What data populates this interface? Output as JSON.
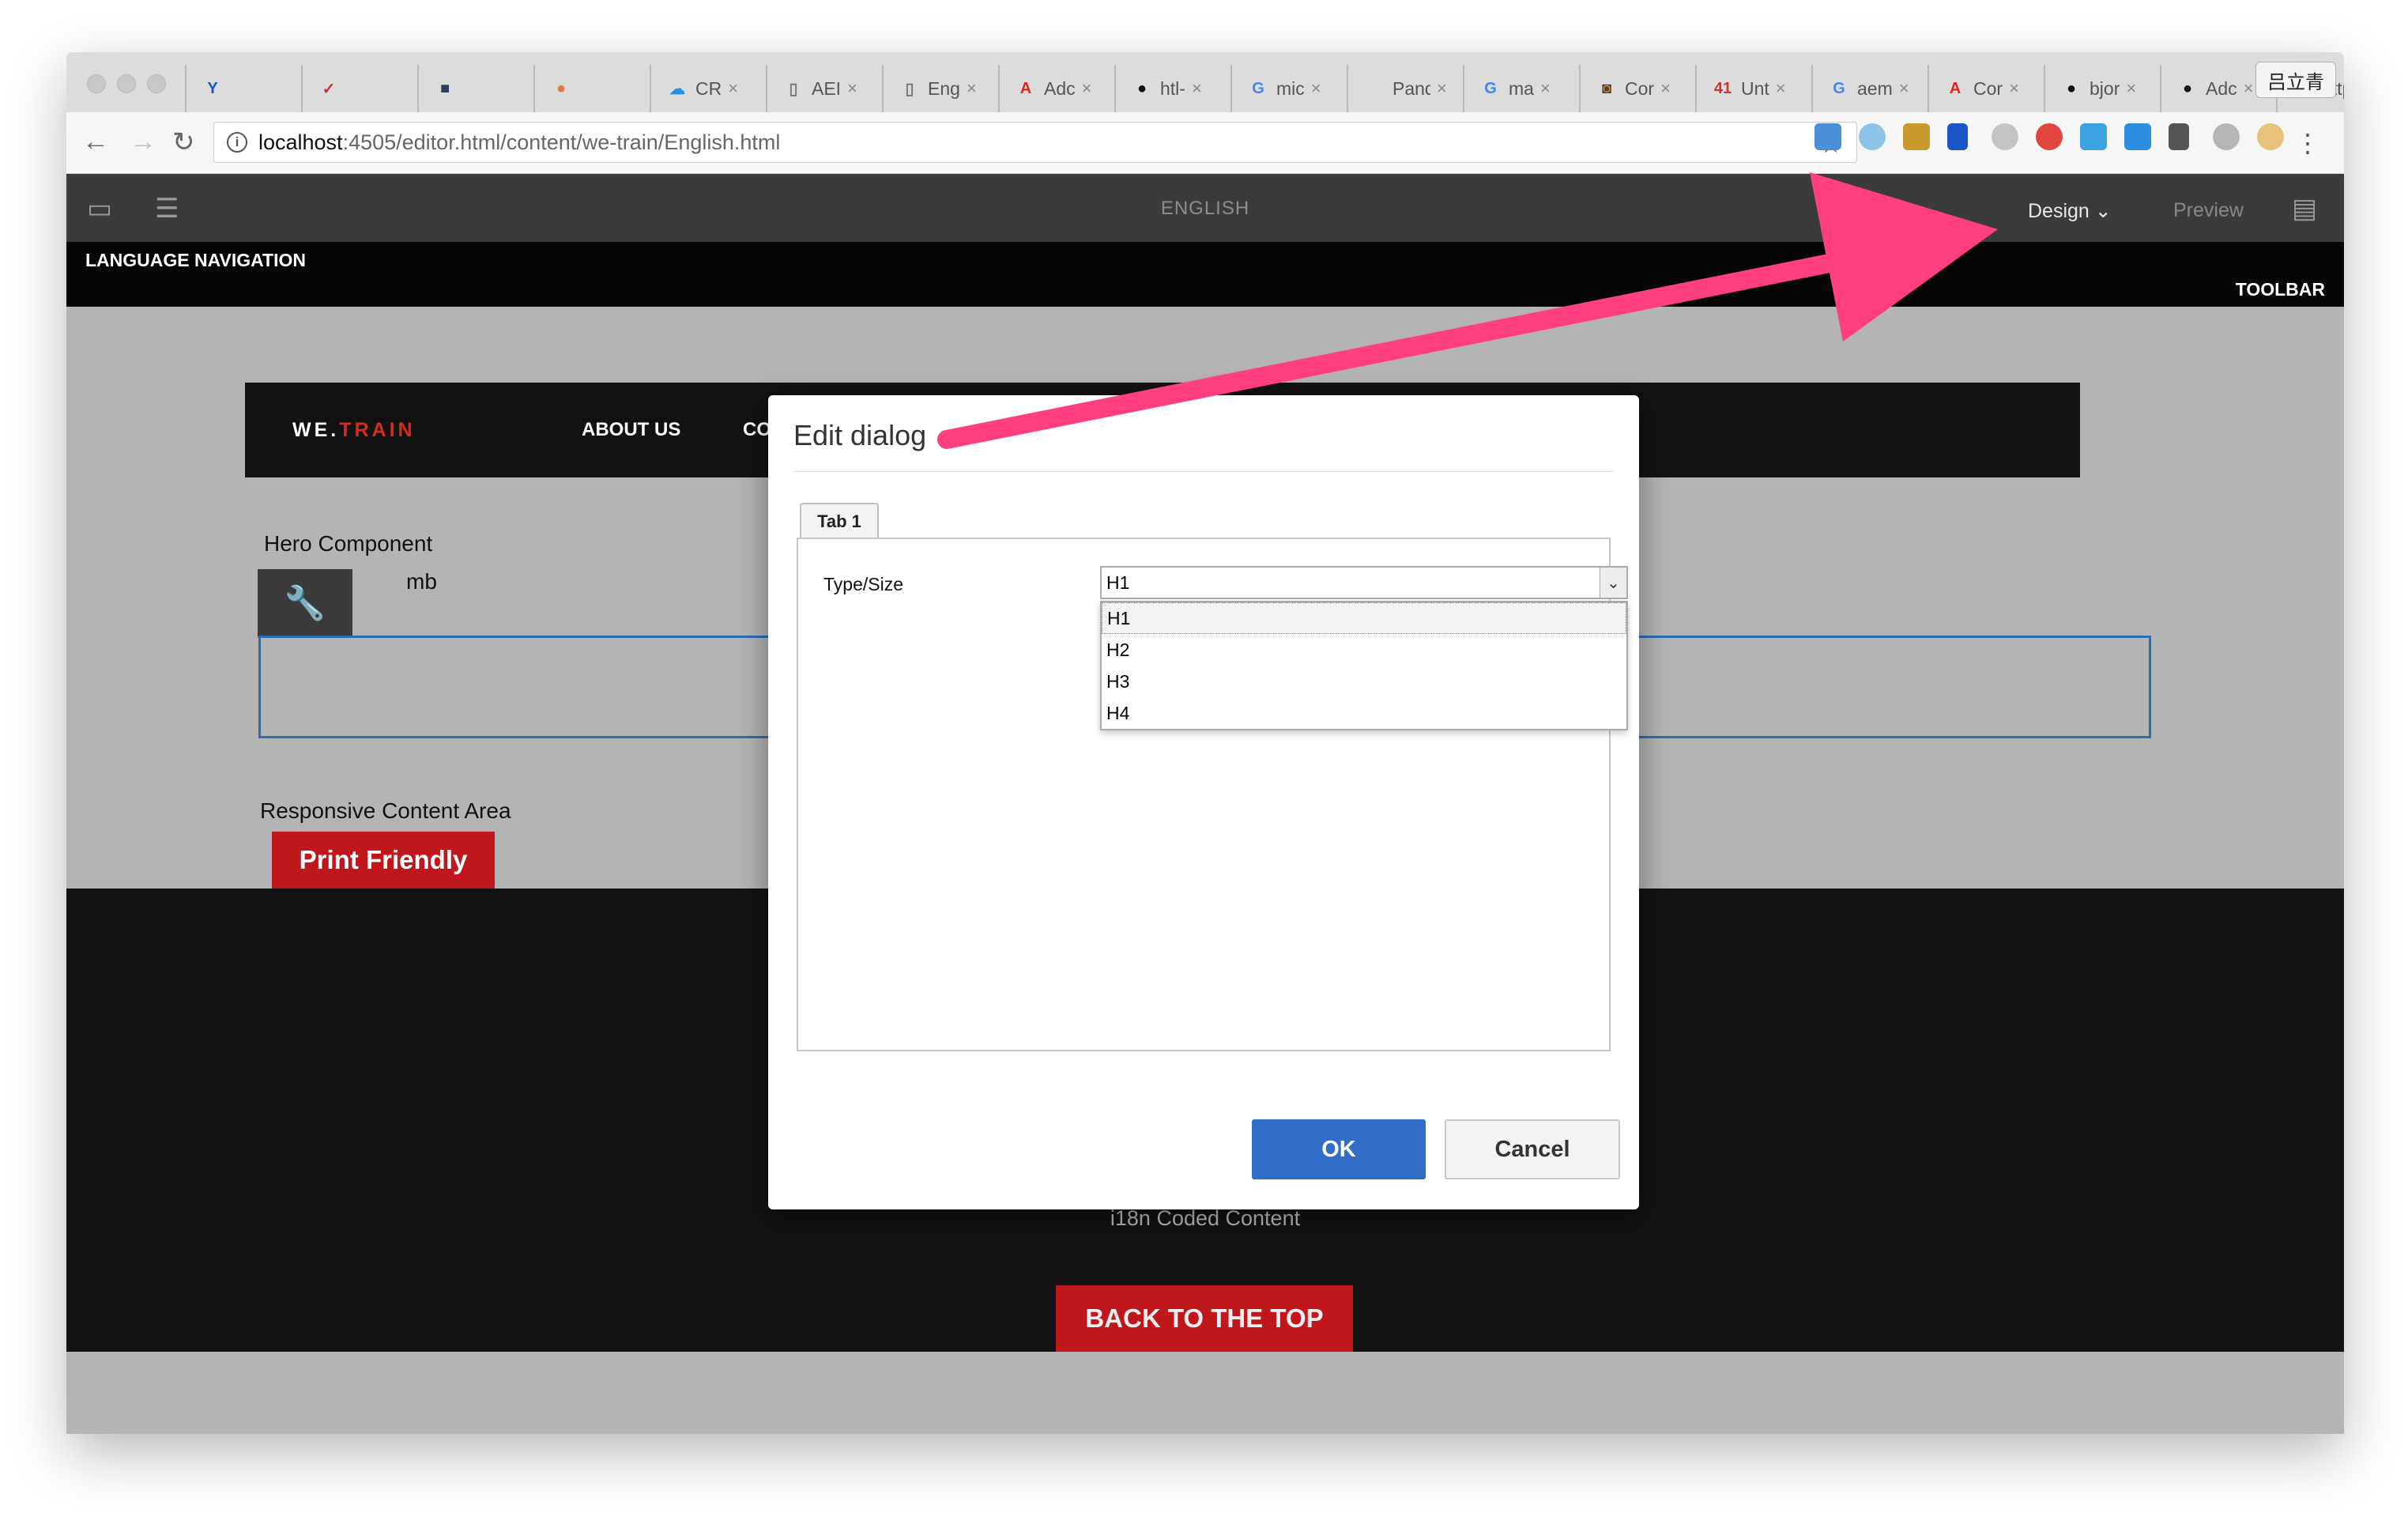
{
  "browser": {
    "profile_name": "吕立青",
    "tabs": [
      {
        "icon": "vivaldi-v-icon",
        "glyph": "Y",
        "color": "#1a56c7",
        "label": ""
      },
      {
        "icon": "todoist-check-icon",
        "glyph": "✓",
        "color": "#d5312a",
        "label": ""
      },
      {
        "icon": "extension-icon",
        "glyph": "■",
        "color": "#2d3e64",
        "label": ""
      },
      {
        "icon": "chrome-icon",
        "glyph": "●",
        "color": "#e2793d",
        "label": ""
      },
      {
        "icon": "crx-icon",
        "glyph": "☁",
        "color": "#2a8fdc",
        "label": "CR"
      },
      {
        "icon": "page-icon",
        "glyph": "▯",
        "color": "#777777",
        "label": "AEI"
      },
      {
        "icon": "page-icon",
        "glyph": "▯",
        "color": "#777777",
        "label": "Eng"
      },
      {
        "icon": "adobe-icon",
        "glyph": "A",
        "color": "#e1251b",
        "label": "Adc"
      },
      {
        "icon": "github-icon",
        "glyph": "●",
        "color": "#111111",
        "label": "htl-"
      },
      {
        "icon": "google-icon",
        "glyph": "G",
        "color": "#4285f4",
        "label": "mic"
      },
      {
        "icon": "none",
        "glyph": "",
        "color": "#777777",
        "label": "Panda"
      },
      {
        "icon": "google-icon",
        "glyph": "G",
        "color": "#4285f4",
        "label": "ma"
      },
      {
        "icon": "cor-icon",
        "glyph": "◙",
        "color": "#6b3c10",
        "label": "Cor"
      },
      {
        "icon": "badge-41-icon",
        "glyph": "41",
        "color": "#d5312a",
        "label": "Unt"
      },
      {
        "icon": "google-icon",
        "glyph": "G",
        "color": "#4285f4",
        "label": "aem"
      },
      {
        "icon": "adobe-icon",
        "glyph": "A",
        "color": "#e1251b",
        "label": "Cor"
      },
      {
        "icon": "github-icon",
        "glyph": "●",
        "color": "#111111",
        "label": "bjor"
      },
      {
        "icon": "github-icon",
        "glyph": "●",
        "color": "#111111",
        "label": "Adc"
      },
      {
        "icon": "page-icon",
        "glyph": "▯",
        "color": "#777777",
        "label": "http"
      }
    ],
    "address": {
      "host": "localhost",
      "path": ":4505/editor.html/content/we-train/English.html"
    }
  },
  "editor_toolbar": {
    "page_title": "ENGLISH",
    "mode": "Design",
    "preview": "Preview"
  },
  "overlay_labels": {
    "language_navigation": "LANGUAGE NAVIGATION",
    "toolbar": "TOOLBAR"
  },
  "site": {
    "logo_prefix": "WE.",
    "logo_suffix": "TRAIN",
    "nav": [
      "ABOUT US",
      "CO"
    ],
    "hero_component": "Hero Component",
    "breadcrumb_fragment": "mb",
    "responsive_content_area": "Responsive Content Area",
    "print_friendly": "Print Friendly",
    "i18n_text": "i18n Coded Content",
    "back_to_top": "BACK TO THE TOP"
  },
  "dialog": {
    "title": "Edit dialog",
    "tab_label": "Tab 1",
    "field_label": "Type/Size",
    "selected_value": "H1",
    "options": [
      "H1",
      "H2",
      "H3",
      "H4"
    ],
    "ok": "OK",
    "cancel": "Cancel"
  },
  "colors": {
    "accent_blue": "#326ec8",
    "brand_red": "#c0171d",
    "annotation_pink": "#ff3f7f"
  }
}
